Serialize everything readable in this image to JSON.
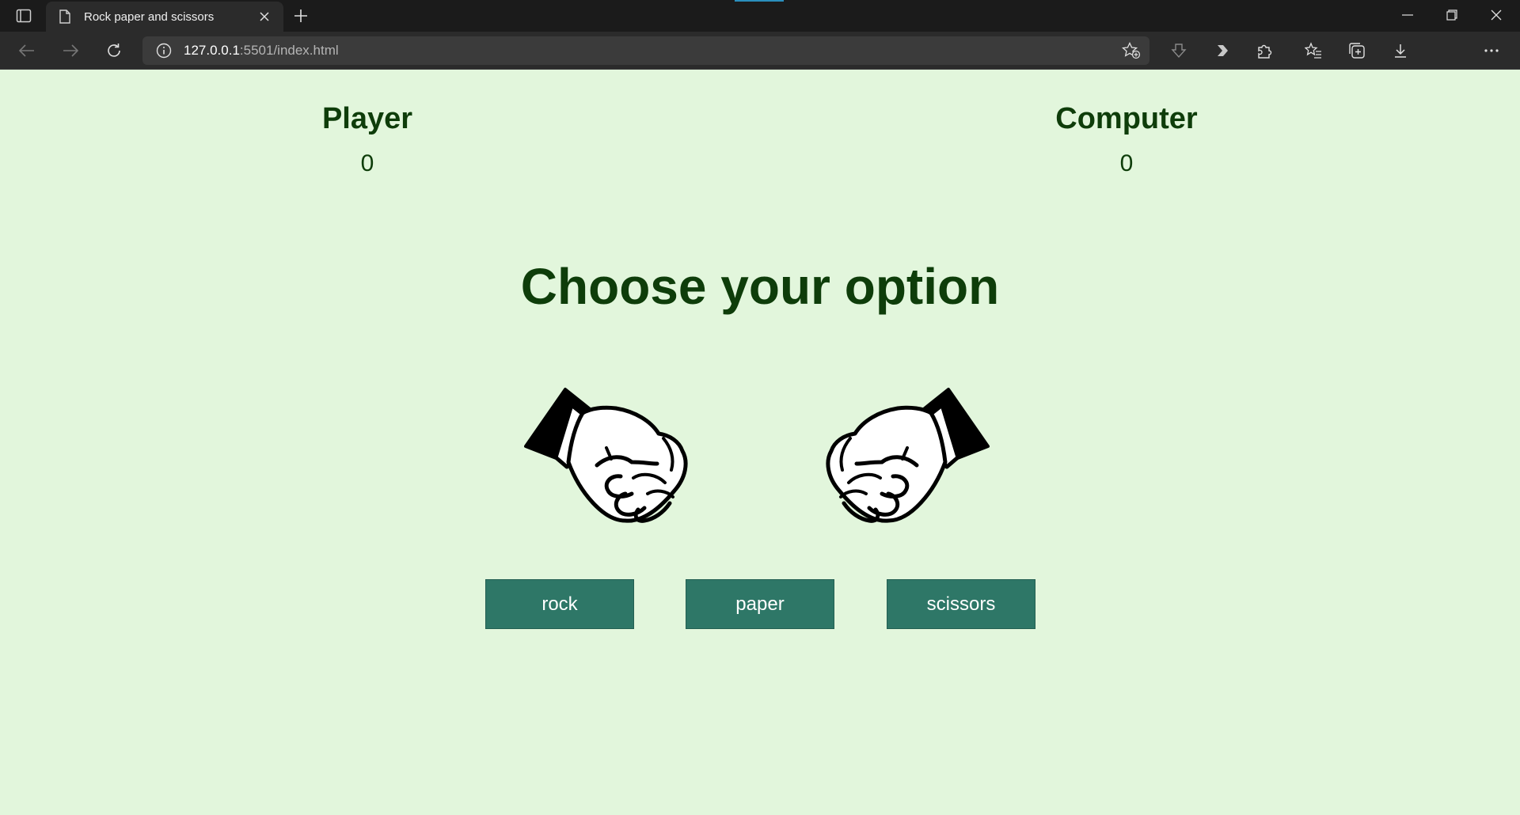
{
  "browser": {
    "tab_title": "Rock paper and scissors",
    "url_host": "127.0.0.1",
    "url_path": ":5501/index.html"
  },
  "icons": {
    "tab_actions": "tab-actions-icon",
    "tab_page": "document-icon",
    "tab_close": "close-icon",
    "new_tab": "plus-icon",
    "back": "arrow-left-icon",
    "forward": "arrow-right-icon",
    "refresh": "refresh-icon",
    "site_info": "info-icon",
    "add_favorite": "star-plus-icon",
    "download_app": "download-arrow-icon",
    "media": "chevron-forward-icon",
    "extensions": "puzzle-icon",
    "favorites": "favorites-icon",
    "collections": "collections-icon",
    "downloads": "download-icon",
    "profile": "profile-icon",
    "menu": "more-icon"
  },
  "game": {
    "player": {
      "label": "Player",
      "score": "0"
    },
    "computer": {
      "label": "Computer",
      "score": "0"
    },
    "heading": "Choose your option",
    "choices": [
      {
        "label": "rock"
      },
      {
        "label": "paper"
      },
      {
        "label": "scissors"
      }
    ]
  },
  "colors": {
    "page_background": "#e2f6dc",
    "text_dark_green": "#0e3d0a",
    "button_green": "#2e7767",
    "browser_dark": "#1b1b1b"
  }
}
